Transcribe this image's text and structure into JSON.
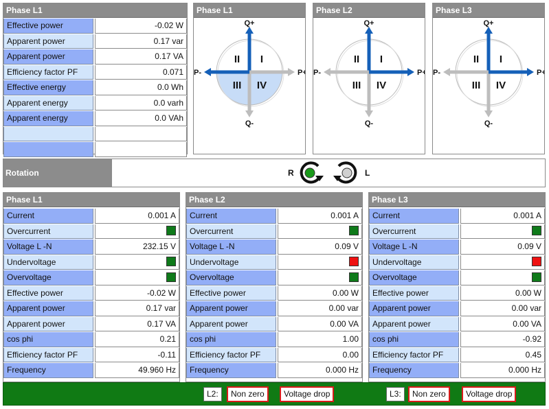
{
  "top_panel": {
    "title": "Phase L1",
    "rows": [
      {
        "label": "Effective power",
        "value": "-0.02 W",
        "shade": "dark"
      },
      {
        "label": "Apparent power",
        "value": "0.17 var",
        "shade": "light"
      },
      {
        "label": "Apparent power",
        "value": "0.17 VA",
        "shade": "dark"
      },
      {
        "label": "Efficiency factor PF",
        "value": "0.071",
        "shade": "light"
      },
      {
        "label": "Effective energy",
        "value": "0.0 Wh",
        "shade": "dark"
      },
      {
        "label": "Apparent energy",
        "value": "0.0 varh",
        "shade": "light"
      },
      {
        "label": "Apparent energy",
        "value": "0.0 VAh",
        "shade": "dark"
      },
      {
        "label": "",
        "value": "",
        "shade": "light"
      },
      {
        "label": "",
        "value": "",
        "shade": "dark"
      }
    ]
  },
  "diagrams": [
    {
      "title": "Phase L1",
      "active_quadrants": [
        "III",
        "IV"
      ],
      "active_arrows": [
        "Q+",
        "P-"
      ]
    },
    {
      "title": "Phase L2",
      "active_quadrants": [],
      "active_arrows": [
        "Q+",
        "P+"
      ]
    },
    {
      "title": "Phase L3",
      "active_quadrants": [],
      "active_arrows": [
        "Q+",
        "P+"
      ]
    }
  ],
  "axis_labels": {
    "top": "Q+",
    "bottom": "Q-",
    "left": "P-",
    "right": "P+"
  },
  "quadrant_labels": {
    "q1": "I",
    "q2": "II",
    "q3": "III",
    "q4": "IV"
  },
  "rotation": {
    "label": "Rotation",
    "right_label": "R",
    "left_label": "L",
    "active": "R"
  },
  "phases": [
    {
      "title": "Phase L1",
      "rows": [
        {
          "label": "Current",
          "value": "0.001 A",
          "shade": "dark"
        },
        {
          "label": "Overcurrent",
          "indicator": "green",
          "shade": "light"
        },
        {
          "label": "Voltage L -N",
          "value": "232.15 V",
          "shade": "dark"
        },
        {
          "label": "Undervoltage",
          "indicator": "green",
          "shade": "light"
        },
        {
          "label": "Overvoltage",
          "indicator": "green",
          "shade": "dark"
        },
        {
          "label": "Effective power",
          "value": "-0.02 W",
          "shade": "light"
        },
        {
          "label": "Apparent power",
          "value": "0.17 var",
          "shade": "dark"
        },
        {
          "label": "Apparent power",
          "value": "0.17 VA",
          "shade": "light"
        },
        {
          "label": "cos phi",
          "value": "0.21",
          "shade": "dark"
        },
        {
          "label": "Efficiency factor PF",
          "value": "-0.11",
          "shade": "light"
        },
        {
          "label": "Frequency",
          "value": "49.960 Hz",
          "shade": "dark"
        }
      ]
    },
    {
      "title": "Phase L2",
      "rows": [
        {
          "label": "Current",
          "value": "0.001 A",
          "shade": "dark"
        },
        {
          "label": "Overcurrent",
          "indicator": "green",
          "shade": "light"
        },
        {
          "label": "Voltage L -N",
          "value": "0.09 V",
          "shade": "dark"
        },
        {
          "label": "Undervoltage",
          "indicator": "red",
          "shade": "light"
        },
        {
          "label": "Overvoltage",
          "indicator": "green",
          "shade": "dark"
        },
        {
          "label": "Effective power",
          "value": "0.00 W",
          "shade": "light"
        },
        {
          "label": "Apparent power",
          "value": "0.00 var",
          "shade": "dark"
        },
        {
          "label": "Apparent power",
          "value": "0.00 VA",
          "shade": "light"
        },
        {
          "label": "cos phi",
          "value": "1.00",
          "shade": "dark"
        },
        {
          "label": "Efficiency factor PF",
          "value": "0.00",
          "shade": "light"
        },
        {
          "label": "Frequency",
          "value": "0.000 Hz",
          "shade": "dark"
        }
      ]
    },
    {
      "title": "Phase L3",
      "rows": [
        {
          "label": "Current",
          "value": "0.001 A",
          "shade": "dark"
        },
        {
          "label": "Overcurrent",
          "indicator": "green",
          "shade": "light"
        },
        {
          "label": "Voltage L -N",
          "value": "0.09 V",
          "shade": "dark"
        },
        {
          "label": "Undervoltage",
          "indicator": "red",
          "shade": "light"
        },
        {
          "label": "Overvoltage",
          "indicator": "green",
          "shade": "dark"
        },
        {
          "label": "Effective power",
          "value": "0.00 W",
          "shade": "light"
        },
        {
          "label": "Apparent power",
          "value": "0.00 var",
          "shade": "dark"
        },
        {
          "label": "Apparent power",
          "value": "0.00 VA",
          "shade": "light"
        },
        {
          "label": "cos phi",
          "value": "-0.92",
          "shade": "dark"
        },
        {
          "label": "Efficiency factor PF",
          "value": "0.45",
          "shade": "light"
        },
        {
          "label": "Frequency",
          "value": "0.000 Hz",
          "shade": "dark"
        }
      ]
    }
  ],
  "status_bar": {
    "l2": {
      "label": "L2:",
      "btn1": "Non zero",
      "btn2": "Voltage drop"
    },
    "l3": {
      "label": "L3:",
      "btn1": "Non zero",
      "btn2": "Voltage drop"
    }
  },
  "colors": {
    "header": "#8c8c8c",
    "row_dark": "#93aef7",
    "row_light": "#d2e5fb",
    "arrow_active": "#1560b8",
    "arrow_inactive": "#bdbdbd",
    "quadrant_active": "#c7dcf7",
    "status_bar": "#107a14",
    "indicator_green": "#0f7a1a",
    "indicator_red": "#ee1111"
  },
  "icons": [
    "rotation-right-icon",
    "rotation-left-icon",
    "status-indicator-icon"
  ]
}
